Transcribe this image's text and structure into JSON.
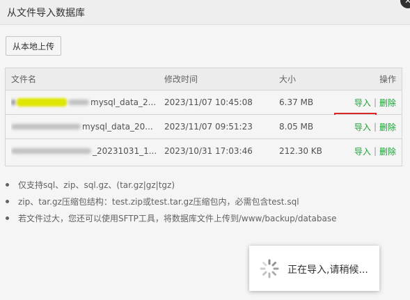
{
  "dialog": {
    "title": "从文件导入数据库",
    "close_icon": "close-icon",
    "upload_label": "从本地上传"
  },
  "table": {
    "headers": {
      "name": "文件名",
      "mtime": "修改时间",
      "size": "大小",
      "ops": "操作"
    },
    "rows": [
      {
        "name_visible": "mysql_data_2...",
        "mtime": "2023/11/07 10:45:08",
        "size": "6.37 MB",
        "import": "导入",
        "sep": "|",
        "delete": "删除"
      },
      {
        "name_visible": "mysql_data_20...",
        "mtime": "2023/11/07 09:51:23",
        "size": "8.05 MB",
        "import": "导入",
        "sep": "|",
        "delete": "删除"
      },
      {
        "name_visible": "_20231031_1...",
        "mtime": "2023/10/31 17:03:46",
        "size": "212.30 KB",
        "import": "导入",
        "sep": "|",
        "delete": "删除"
      }
    ]
  },
  "tips": [
    "仅支持sql、zip、sql.gz、(tar.gz|gz|tgz)",
    "zip、tar.gz压缩包结构：test.zip或test.tar.gz压缩包内，必需包含test.sql",
    "若文件过大，您还可以使用SFTP工具，将数据库文件上传到/www/backup/database"
  ],
  "loading": {
    "text": "正在导入,请稍候...",
    "icon": "spinner-icon"
  },
  "colors": {
    "link": "#20a53a",
    "highlight": "#e32a2a"
  }
}
